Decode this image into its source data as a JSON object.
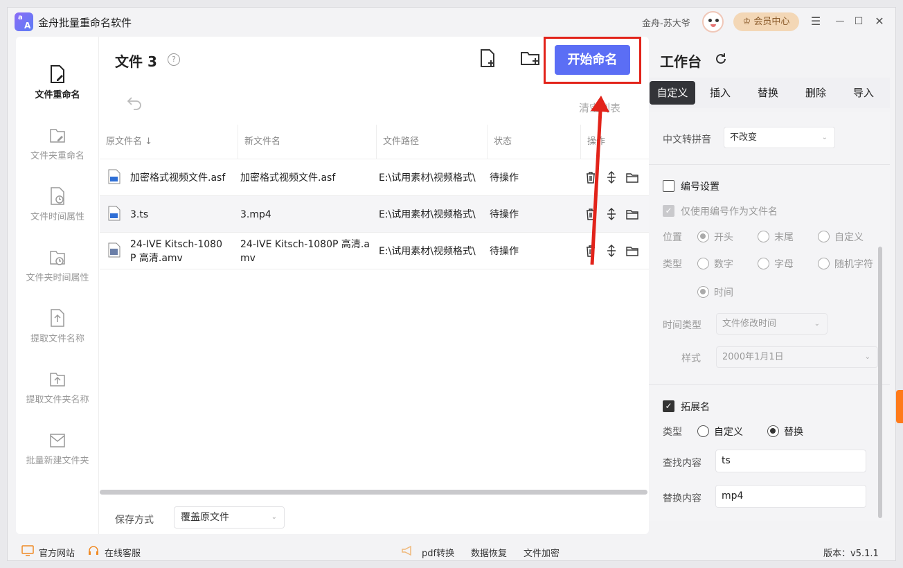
{
  "app": {
    "title": "金舟批量重命名软件",
    "logo_letters": [
      "a",
      "A"
    ],
    "user_name": "金舟-苏大爷",
    "member_center": "会员中心",
    "window_controls": [
      "☰",
      "—",
      "☐",
      "✕"
    ]
  },
  "sidebar": {
    "items": [
      {
        "label": "文件重命名",
        "icon": "file-edit-icon",
        "active": true
      },
      {
        "label": "文件夹重命名",
        "icon": "folder-edit-icon",
        "active": false
      },
      {
        "label": "文件时间属性",
        "icon": "file-clock-icon",
        "active": false
      },
      {
        "label": "文件夹时间属性",
        "icon": "folder-clock-icon",
        "active": false
      },
      {
        "label": "提取文件名称",
        "icon": "file-export-icon",
        "active": false
      },
      {
        "label": "提取文件夹名称",
        "icon": "folder-export-icon",
        "active": false
      },
      {
        "label": "批量新建文件夹",
        "icon": "new-folder-icon",
        "active": false
      }
    ]
  },
  "main": {
    "title": "文件 3",
    "help": "?",
    "start_button": "开始命名",
    "clear_list": "清空列表",
    "columns": [
      "原文件名 ↓",
      "新文件名",
      "文件路径",
      "状态",
      "操作"
    ],
    "rows": [
      {
        "original": "加密格式视频文件.asf",
        "new_name": "加密格式视频文件.asf",
        "path": "E:\\试用素材\\视频格式\\",
        "status": "待操作"
      },
      {
        "original": "3.ts",
        "new_name": "3.mp4",
        "path": "E:\\试用素材\\视频格式\\",
        "status": "待操作"
      },
      {
        "original": "24-IVE Kitsch-1080P 高清.amv",
        "new_name": "24-IVE Kitsch-1080P 高清.amv",
        "path": "E:\\试用素材\\视频格式\\",
        "status": "待操作"
      }
    ],
    "save_mode_label": "保存方式",
    "save_mode_value": "覆盖原文件"
  },
  "workbench": {
    "title": "工作台",
    "tabs": [
      "自定义",
      "插入",
      "替换",
      "删除",
      "导入"
    ],
    "active_tab": "自定义",
    "pinyin_label": "中文转拼音",
    "pinyin_value": "不改变",
    "numbering_label": "编号设置",
    "numbering_only_label": "仅使用编号作为文件名",
    "position_label": "位置",
    "position_options": [
      "开头",
      "末尾",
      "自定义"
    ],
    "type_label": "类型",
    "type_options": [
      "数字",
      "字母",
      "随机字符",
      "时间"
    ],
    "time_type_label": "时间类型",
    "time_type_value": "文件修改时间",
    "style_label": "样式",
    "style_value": "2000年1月1日",
    "extension_label": "拓展名",
    "ext_type_label": "类型",
    "ext_type_options": [
      "自定义",
      "替换"
    ],
    "find_label": "查找内容",
    "find_value": "ts",
    "replace_label": "替换内容",
    "replace_value": "mp4"
  },
  "footer": {
    "website": "官方网站",
    "service": "在线客服",
    "pdf": "pdf转换",
    "recovery": "数据恢复",
    "encrypt": "文件加密",
    "version": "版本：v5.1.1"
  },
  "colors": {
    "accent": "#5b6ef5",
    "highlight_box": "#e2231a",
    "arrow": "#e2231a",
    "member": "#f3d7b6"
  }
}
